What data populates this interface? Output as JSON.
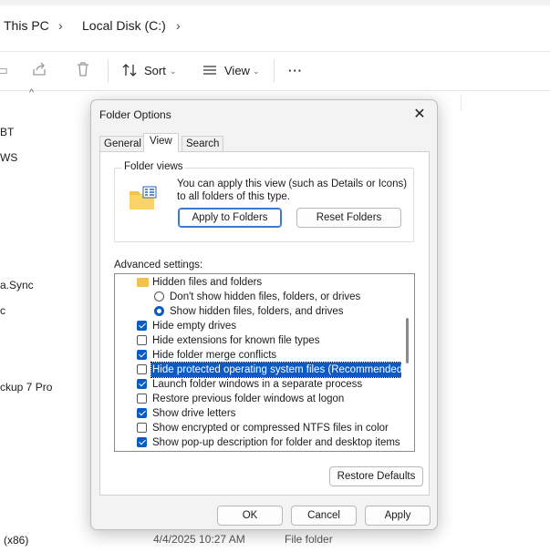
{
  "explorer": {
    "breadcrumb": [
      "This PC",
      "Local Disk (C:)"
    ],
    "toolbar": {
      "sort_label": "Sort",
      "view_label": "View",
      "more_label": "···"
    },
    "list_fragments": [
      "BT",
      "WS",
      "a.Sync",
      "c",
      "ckup 7 Pro",
      "(x86)"
    ],
    "bottom_row": {
      "date": "4/4/2025 10:27 AM",
      "type": "File folder"
    }
  },
  "dialog": {
    "title": "Folder Options",
    "close_label": "✕",
    "tabs": [
      "General",
      "View",
      "Search"
    ],
    "active_tab": "View",
    "folder_views": {
      "title": "Folder views",
      "description": "You can apply this view (such as Details or Icons) to all folders of this type.",
      "apply_label": "Apply to Folders",
      "reset_label": "Reset Folders"
    },
    "advanced_label": "Advanced settings:",
    "settings": [
      {
        "type": "folder",
        "label": "Hidden files and folders"
      },
      {
        "type": "radio",
        "label": "Don't show hidden files, folders, or drives",
        "checked": false
      },
      {
        "type": "radio",
        "label": "Show hidden files, folders, and drives",
        "checked": true
      },
      {
        "type": "check",
        "label": "Hide empty drives",
        "checked": true
      },
      {
        "type": "check",
        "label": "Hide extensions for known file types",
        "checked": false
      },
      {
        "type": "check",
        "label": "Hide folder merge conflicts",
        "checked": true
      },
      {
        "type": "check",
        "label": "Hide protected operating system files (Recommended)",
        "checked": false,
        "selected": true
      },
      {
        "type": "check",
        "label": "Launch folder windows in a separate process",
        "checked": true
      },
      {
        "type": "check",
        "label": "Restore previous folder windows at logon",
        "checked": false
      },
      {
        "type": "check",
        "label": "Show drive letters",
        "checked": true
      },
      {
        "type": "check",
        "label": "Show encrypted or compressed NTFS files in color",
        "checked": false
      },
      {
        "type": "check",
        "label": "Show pop-up description for folder and desktop items",
        "checked": true
      }
    ],
    "restore_defaults_label": "Restore Defaults",
    "ok_label": "OK",
    "cancel_label": "Cancel",
    "apply_label": "Apply",
    "accent_color": "#0a5bc4"
  }
}
